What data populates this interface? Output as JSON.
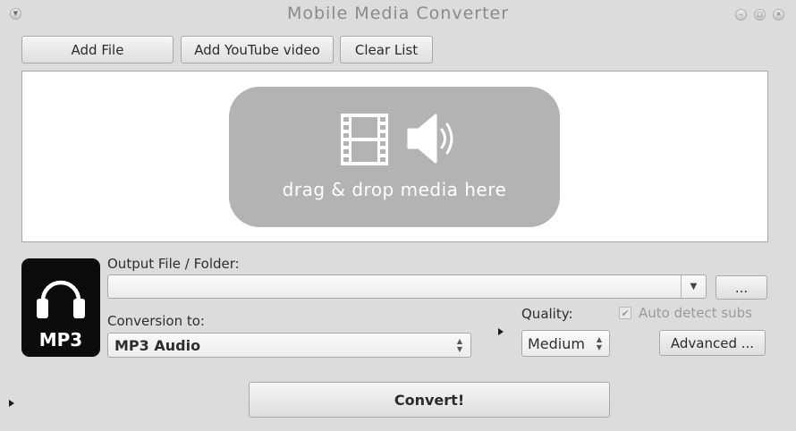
{
  "window": {
    "title": "Mobile Media Converter",
    "menu_icon": "chevron-down-icon",
    "controls": [
      "minimize-icon",
      "maximize-icon",
      "close-icon"
    ]
  },
  "toolbar": {
    "add_file": "Add File",
    "add_youtube": "Add YouTube video",
    "clear_list": "Clear List"
  },
  "drop_area": {
    "text": "drag & drop media here",
    "icons": [
      "film-strip-icon",
      "speaker-icon"
    ]
  },
  "format": {
    "badge": "MP3",
    "icon": "headphones-icon"
  },
  "output": {
    "label": "Output File / Folder:",
    "value": "",
    "browse_label": "..."
  },
  "conversion": {
    "label": "Conversion to:",
    "selected": "MP3 Audio"
  },
  "quality": {
    "label": "Quality:",
    "selected": "Medium"
  },
  "subs": {
    "label": "Auto detect subs",
    "checked": true
  },
  "advanced": {
    "label": "Advanced ..."
  },
  "convert": {
    "label": "Convert!"
  },
  "colors": {
    "background": "#dcdcdc",
    "drop_zone": "#b3b3b3",
    "icon_tile": "#0c0c0c"
  }
}
